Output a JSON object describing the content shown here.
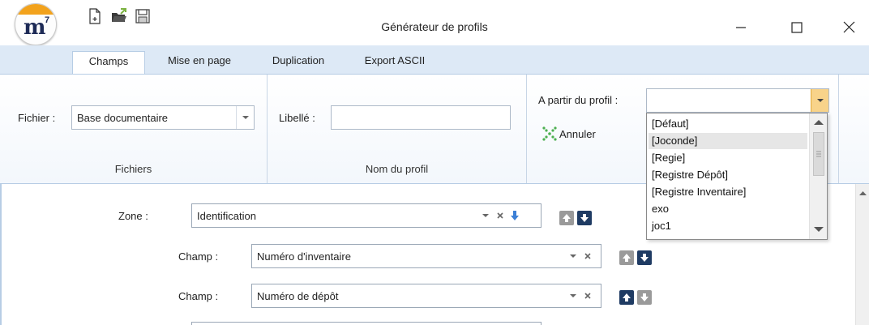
{
  "window": {
    "title": "Générateur de profils",
    "logo_text": "m",
    "logo_sup": "7"
  },
  "quick_access": [
    "new-file-icon",
    "open-folder-icon",
    "save-icon"
  ],
  "tabs": [
    {
      "label": "Champs",
      "active": true
    },
    {
      "label": "Mise en page",
      "active": false
    },
    {
      "label": "Duplication",
      "active": false
    },
    {
      "label": "Export ASCII",
      "active": false
    }
  ],
  "ribbon": {
    "fichiers": {
      "label": "Fichier :",
      "value": "Base documentaire",
      "group_label": "Fichiers"
    },
    "nom_profil": {
      "label": "Libellé :",
      "value": "",
      "group_label": "Nom du profil"
    },
    "profil": {
      "label": "A partir du profil :",
      "value": "",
      "annuler_label": "Annuler"
    }
  },
  "dropdown": {
    "options": [
      "[Défaut]",
      "[Joconde]",
      "[Regie]",
      "[Registre Dépôt]",
      "[Registre Inventaire]",
      "exo",
      "joc1"
    ],
    "highlighted_index": 1
  },
  "main": {
    "zone": {
      "label": "Zone :",
      "value": "Identification"
    },
    "champs": [
      {
        "label": "Champ :",
        "value": "Numéro d'inventaire",
        "up_enabled": false,
        "down_enabled": true
      },
      {
        "label": "Champ :",
        "value": "Numéro de dépôt",
        "up_enabled": true,
        "down_enabled": false
      }
    ]
  },
  "colors": {
    "ribbon_blue": "#dde9f6",
    "accent_navy": "#1f3b63",
    "logo_orange": "#f2a21c",
    "annuler_green": "#4caf50",
    "dropdown_button": "#f8d38a"
  }
}
